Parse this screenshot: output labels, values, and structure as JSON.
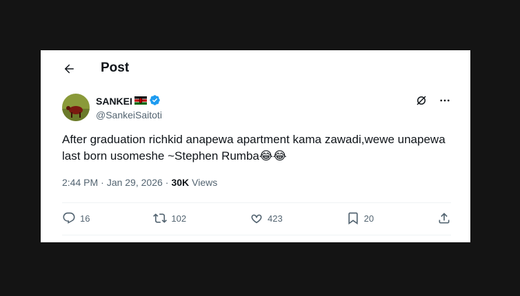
{
  "header": {
    "title": "Post"
  },
  "author": {
    "name": "SANKEI",
    "handle": "@SankeiSaitoti"
  },
  "tweet": {
    "text": "After graduation richkid anapewa apartment kama zawadi,wewe unapewa last born usomeshe ~Stephen Rumba😂😂"
  },
  "meta": {
    "time": "2:44 PM",
    "separator": "·",
    "date": "Jan 29, 2026",
    "views_count": "30K",
    "views_label": "Views"
  },
  "actions": {
    "replies": "16",
    "reposts": "102",
    "likes": "423",
    "bookmarks": "20"
  },
  "colors": {
    "verified": "#1d9bf0",
    "muted": "#536471",
    "text": "#0f1419",
    "backdrop": "#141414"
  }
}
